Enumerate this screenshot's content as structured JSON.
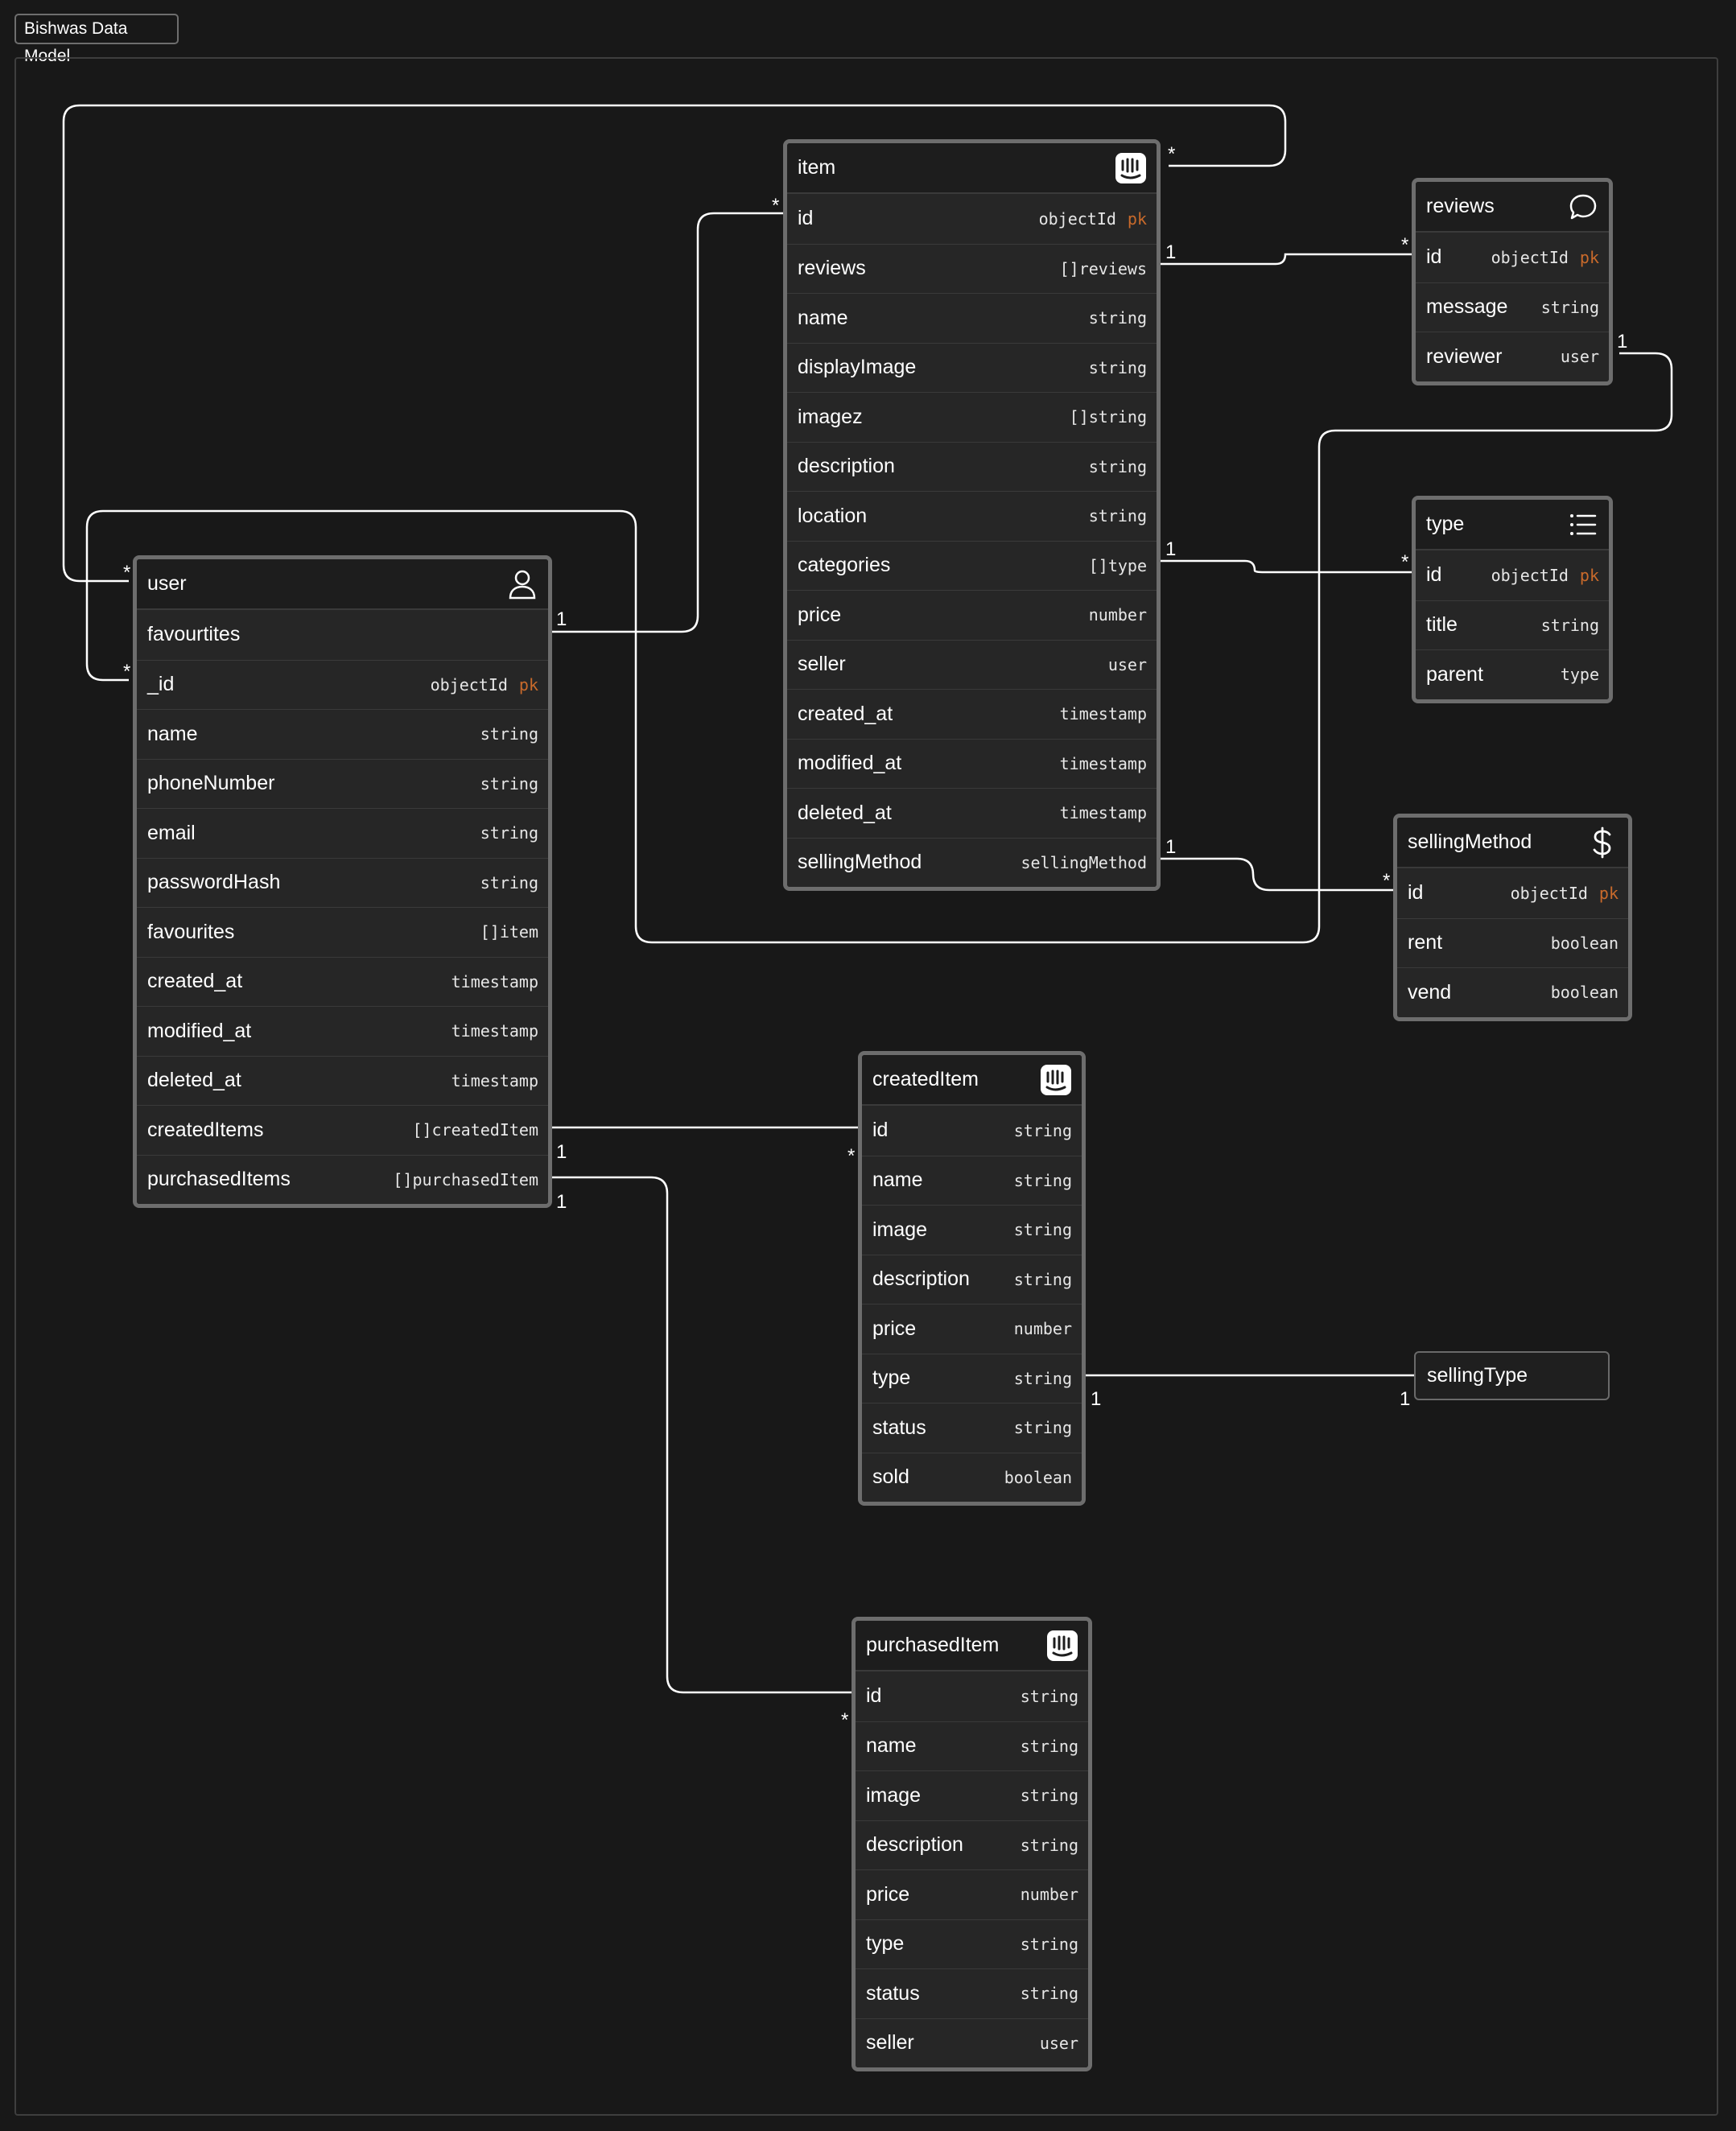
{
  "canvas": {
    "title": "Bishwas Data Model"
  },
  "tables": {
    "item": {
      "title": "item",
      "icon": "intercom-icon",
      "fields": [
        {
          "name": "id",
          "type": "objectId",
          "pk": "pk"
        },
        {
          "name": "reviews",
          "type": "[]reviews"
        },
        {
          "name": "name",
          "type": "string"
        },
        {
          "name": "displayImage",
          "type": "string"
        },
        {
          "name": "imagez",
          "type": "[]string"
        },
        {
          "name": "description",
          "type": "string"
        },
        {
          "name": "location",
          "type": "string"
        },
        {
          "name": "categories",
          "type": "[]type"
        },
        {
          "name": "price",
          "type": "number"
        },
        {
          "name": "seller",
          "type": "user"
        },
        {
          "name": "created_at",
          "type": "timestamp"
        },
        {
          "name": "modified_at",
          "type": "timestamp"
        },
        {
          "name": "deleted_at",
          "type": "timestamp"
        },
        {
          "name": "sellingMethod",
          "type": "sellingMethod"
        }
      ]
    },
    "reviews": {
      "title": "reviews",
      "icon": "speech-bubble-icon",
      "fields": [
        {
          "name": "id",
          "type": "objectId",
          "pk": "pk"
        },
        {
          "name": "message",
          "type": "string"
        },
        {
          "name": "reviewer",
          "type": "user"
        }
      ]
    },
    "type": {
      "title": "type",
      "icon": "list-icon",
      "fields": [
        {
          "name": "id",
          "type": "objectId",
          "pk": "pk"
        },
        {
          "name": "title",
          "type": "string"
        },
        {
          "name": "parent",
          "type": "type"
        }
      ]
    },
    "sellingMethod": {
      "title": "sellingMethod",
      "icon": "dollar-icon",
      "fields": [
        {
          "name": "id",
          "type": "objectId",
          "pk": "pk"
        },
        {
          "name": "rent",
          "type": "boolean"
        },
        {
          "name": "vend",
          "type": "boolean"
        }
      ]
    },
    "user": {
      "title": "user",
      "icon": "user-icon",
      "fields": [
        {
          "name": "favourtites",
          "type": ""
        },
        {
          "name": "_id",
          "type": "objectId",
          "pk": "pk"
        },
        {
          "name": "name",
          "type": "string"
        },
        {
          "name": "phoneNumber",
          "type": "string"
        },
        {
          "name": "email",
          "type": "string"
        },
        {
          "name": "passwordHash",
          "type": "string"
        },
        {
          "name": "favourites",
          "type": "[]item"
        },
        {
          "name": "created_at",
          "type": "timestamp"
        },
        {
          "name": "modified_at",
          "type": "timestamp"
        },
        {
          "name": "deleted_at",
          "type": "timestamp"
        },
        {
          "name": "createdItems",
          "type": "[]createdItem"
        },
        {
          "name": "purchasedItems",
          "type": "[]purchasedItem"
        }
      ]
    },
    "createdItem": {
      "title": "createdItem",
      "icon": "intercom-icon",
      "fields": [
        {
          "name": "id",
          "type": "string"
        },
        {
          "name": "name",
          "type": "string"
        },
        {
          "name": "image",
          "type": "string"
        },
        {
          "name": "description",
          "type": "string"
        },
        {
          "name": "price",
          "type": "number"
        },
        {
          "name": "type",
          "type": "string"
        },
        {
          "name": "status",
          "type": "string"
        },
        {
          "name": "sold",
          "type": "boolean"
        }
      ]
    },
    "purchasedItem": {
      "title": "purchasedItem",
      "icon": "intercom-icon",
      "fields": [
        {
          "name": "id",
          "type": "string"
        },
        {
          "name": "name",
          "type": "string"
        },
        {
          "name": "image",
          "type": "string"
        },
        {
          "name": "description",
          "type": "string"
        },
        {
          "name": "price",
          "type": "number"
        },
        {
          "name": "type",
          "type": "string"
        },
        {
          "name": "status",
          "type": "string"
        },
        {
          "name": "seller",
          "type": "user"
        }
      ]
    }
  },
  "sellingType": {
    "title": "sellingType"
  },
  "cardinality": {
    "one": "1",
    "many": "*"
  }
}
